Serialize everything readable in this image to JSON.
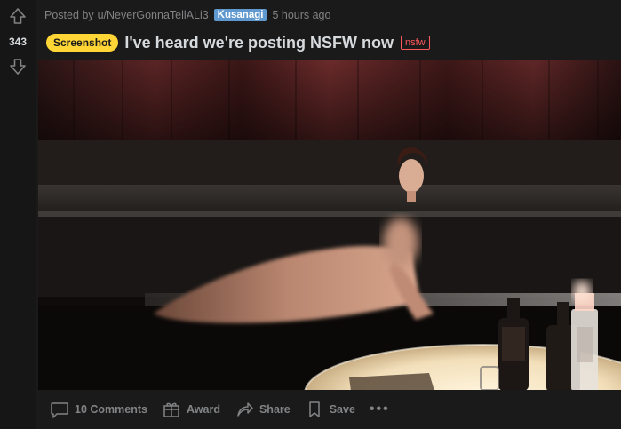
{
  "vote": {
    "count": "343"
  },
  "meta": {
    "posted_by": "Posted by",
    "user": "u/NeverGonnaTellALi3",
    "user_flair": "Kusanagi",
    "time": "5 hours ago"
  },
  "post": {
    "flair": "Screenshot",
    "title": "I've heard we're posting NSFW now",
    "nsfw_tag": "nsfw"
  },
  "actions": {
    "comments": "10 Comments",
    "award": "Award",
    "share": "Share",
    "save": "Save",
    "more": "•••"
  },
  "colors": {
    "background": "#1a1a1b",
    "flair_post": "#ffd635",
    "flair_user": "#5f99cf",
    "nsfw": "#ff585b",
    "muted_text": "#818384"
  },
  "icons": {
    "upvote": "arrow-up-icon",
    "downvote": "arrow-down-icon",
    "comments": "comment-icon",
    "award": "gift-icon",
    "share": "share-icon",
    "save": "bookmark-icon"
  }
}
